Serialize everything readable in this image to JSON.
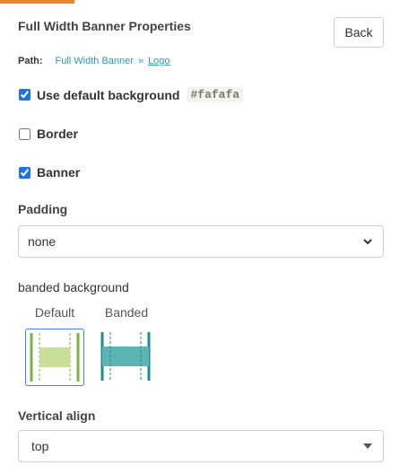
{
  "header": {
    "title": "Full Width Banner Properties",
    "back_label": "Back"
  },
  "path": {
    "label": "Path:",
    "parent": "Full Width Banner",
    "separator": "»",
    "current": "Logo"
  },
  "options": {
    "use_default_background": {
      "label": "Use default background",
      "checked": true,
      "color_code": "#fafafa"
    },
    "border": {
      "label": "Border",
      "checked": false
    },
    "banner": {
      "label": "Banner",
      "checked": true
    }
  },
  "padding": {
    "label": "Padding",
    "value": "none"
  },
  "banded_background": {
    "label": "banded background",
    "options": [
      {
        "caption": "Default",
        "selected": true,
        "color": "#c8df9a",
        "bar_color": "#7cb342"
      },
      {
        "caption": "Banded",
        "selected": false,
        "color": "#5bb5b5",
        "bar_color": "#1a8f8f"
      }
    ]
  },
  "vertical_align": {
    "label": "Vertical align",
    "value": "top"
  },
  "colors": {
    "accent": "#e8872a",
    "link": "#2a9bb5",
    "checkbox": "#1a73e8"
  }
}
